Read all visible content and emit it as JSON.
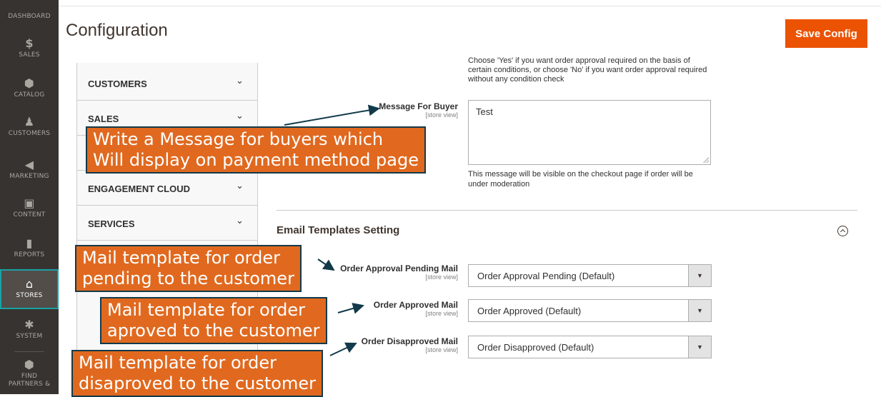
{
  "sidebar": {
    "items": [
      {
        "label": "DASHBOARD",
        "icon": "dashboard-icon",
        "glyph": "▦"
      },
      {
        "label": "SALES",
        "icon": "dollar-icon",
        "glyph": "$"
      },
      {
        "label": "CATALOG",
        "icon": "cube-icon",
        "glyph": "⬢"
      },
      {
        "label": "CUSTOMERS",
        "icon": "person-icon",
        "glyph": "♟"
      },
      {
        "label": "MARKETING",
        "icon": "megaphone-icon",
        "glyph": "◀"
      },
      {
        "label": "CONTENT",
        "icon": "layout-icon",
        "glyph": "▣"
      },
      {
        "label": "REPORTS",
        "icon": "bar-chart-icon",
        "glyph": "▮"
      },
      {
        "label": "STORES",
        "icon": "storefront-icon",
        "glyph": "⌂"
      },
      {
        "label": "SYSTEM",
        "icon": "gear-icon",
        "glyph": "✱"
      },
      {
        "label": "FIND PARTNERS &",
        "icon": "partners-cube-icon",
        "glyph": "⬢"
      }
    ]
  },
  "header": {
    "title": "Configuration",
    "save_label": "Save Config"
  },
  "tabs": [
    {
      "label": "CUSTOMERS"
    },
    {
      "label": "SALES"
    },
    {
      "label": ""
    },
    {
      "label": "ENGAGEMENT CLOUD"
    },
    {
      "label": "SERVICES"
    }
  ],
  "form": {
    "help_top": "Choose 'Yes' if you want order approval required on the basis of certain conditions, or choose 'No' if you want order approval required without any condition check",
    "message_label": "Message For Buyer",
    "scope": "[store view]",
    "message_value": "Test",
    "message_help": "This message will be visible on the checkout page if order will be under moderation",
    "section_title": "Email Templates Setting",
    "pending_label": "Order Approval Pending Mail",
    "pending_value": "Order Approval Pending (Default)",
    "approved_label": "Order Approved Mail",
    "approved_value": "Order Approved (Default)",
    "disapproved_label": "Order Disapproved Mail",
    "disapproved_value": "Order Disapproved (Default)"
  },
  "callouts": {
    "message": [
      "Write a Message for buyers which",
      "Will display on payment method page"
    ],
    "pending": [
      "Mail template for order",
      "pending to the customer"
    ],
    "approved": [
      "Mail template for order",
      "aproved to the customer"
    ],
    "disapproved": [
      "Mail template for order",
      "disaproved to the customer"
    ]
  },
  "colors": {
    "accent": "#eb5202",
    "callout": "#e0691f",
    "sidebar": "#373330",
    "active_border": "#17a2a6"
  }
}
